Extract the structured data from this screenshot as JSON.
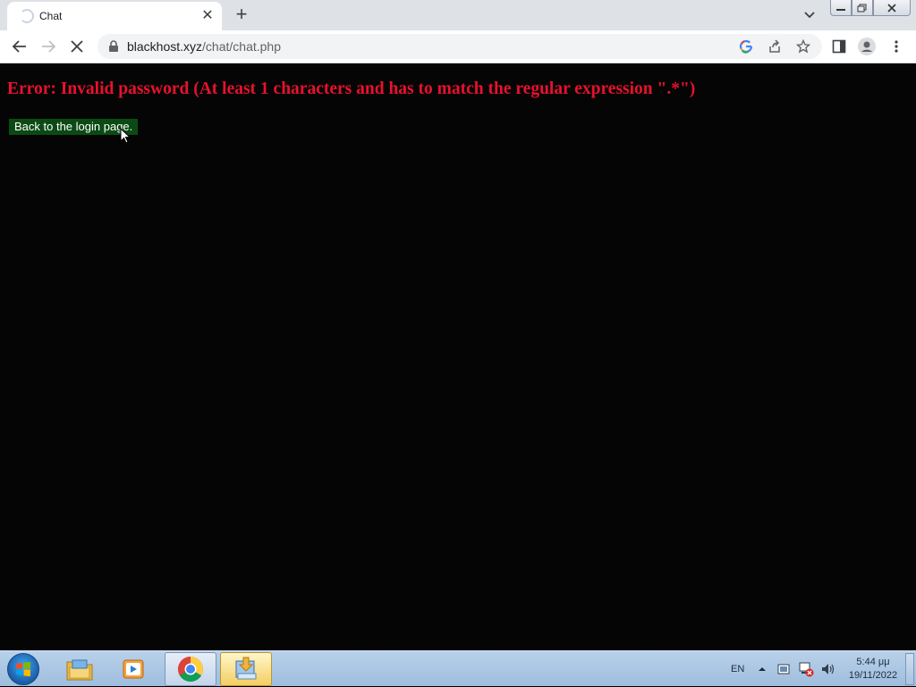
{
  "browser": {
    "tab_title": "Chat",
    "tab_close": "✕",
    "new_tab": "+",
    "url_domain": "blackhost.xyz",
    "url_path": "/chat/chat.php"
  },
  "page": {
    "error_message": "Error: Invalid password (At least 1 characters and has to match the regular expression \".*\")",
    "back_link": "Back to the login page."
  },
  "taskbar": {
    "language": "EN",
    "time": "5:44 μμ",
    "date": "19/11/2022"
  },
  "colors": {
    "error_text": "#e8112d",
    "link_background": "#0b4a14",
    "page_background": "#050505"
  }
}
